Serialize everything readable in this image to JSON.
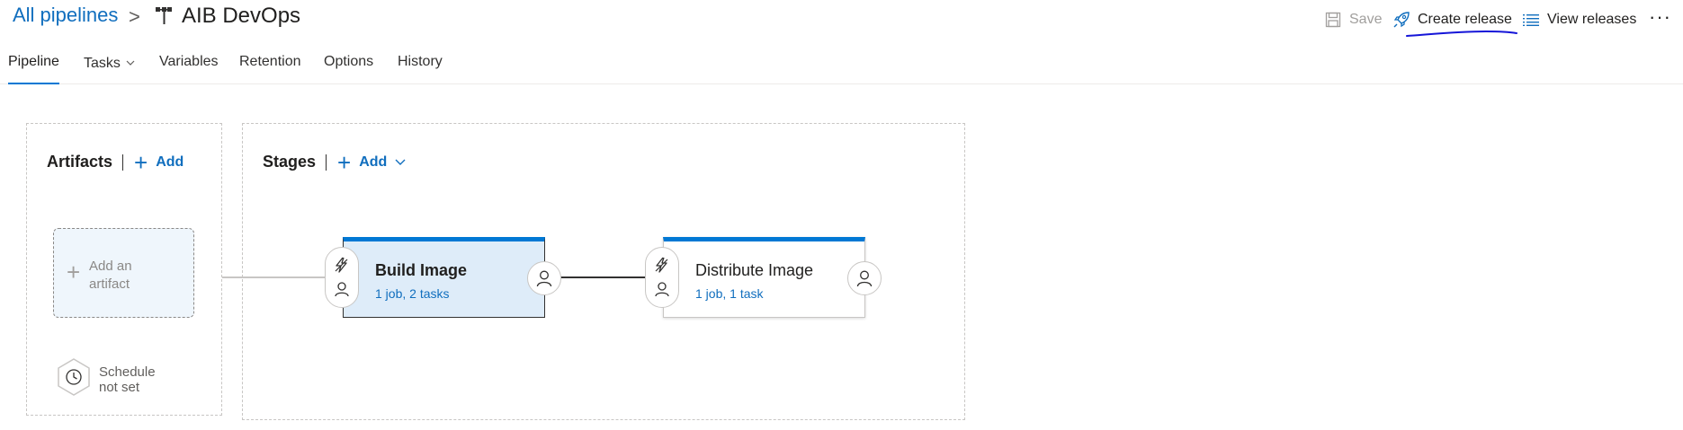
{
  "colors": {
    "accent": "#0078d4",
    "link": "#106ebe",
    "selected_stage_bg": "#deecf9",
    "annotation_ink": "#1515d8"
  },
  "header": {
    "breadcrumb_root": "All pipelines",
    "breadcrumb_separator": ">",
    "pipeline_icon": "release-pipeline-icon",
    "pipeline_name": "AIB DevOps",
    "toolbar": {
      "save": {
        "label": "Save",
        "icon": "save-icon",
        "disabled": true
      },
      "create_release": {
        "label": "Create release",
        "icon": "rocket-icon"
      },
      "view_releases": {
        "label": "View releases",
        "icon": "list-icon"
      },
      "more": {
        "label": "···",
        "icon": "more-icon"
      }
    }
  },
  "tabs": [
    {
      "label": "Pipeline",
      "active": true
    },
    {
      "label": "Tasks",
      "has_dropdown": true
    },
    {
      "label": "Variables"
    },
    {
      "label": "Retention"
    },
    {
      "label": "Options"
    },
    {
      "label": "History"
    }
  ],
  "artifacts": {
    "title": "Artifacts",
    "add_label": "Add",
    "add_artifact_label": "Add an artifact",
    "schedule_label_line1": "Schedule",
    "schedule_label_line2": "not set",
    "schedule_icon": "clock-icon"
  },
  "stages": {
    "title": "Stages",
    "add_label": "Add",
    "items": [
      {
        "name": "Build Image",
        "summary": "1 job, 2 tasks",
        "selected": true,
        "pre_icons": [
          "lightning-icon",
          "person-icon"
        ],
        "post_icon": "person-icon"
      },
      {
        "name": "Distribute Image",
        "summary": "1 job, 1 task",
        "selected": false,
        "pre_icons": [
          "lightning-icon",
          "person-icon"
        ],
        "post_icon": "person-icon"
      }
    ]
  }
}
